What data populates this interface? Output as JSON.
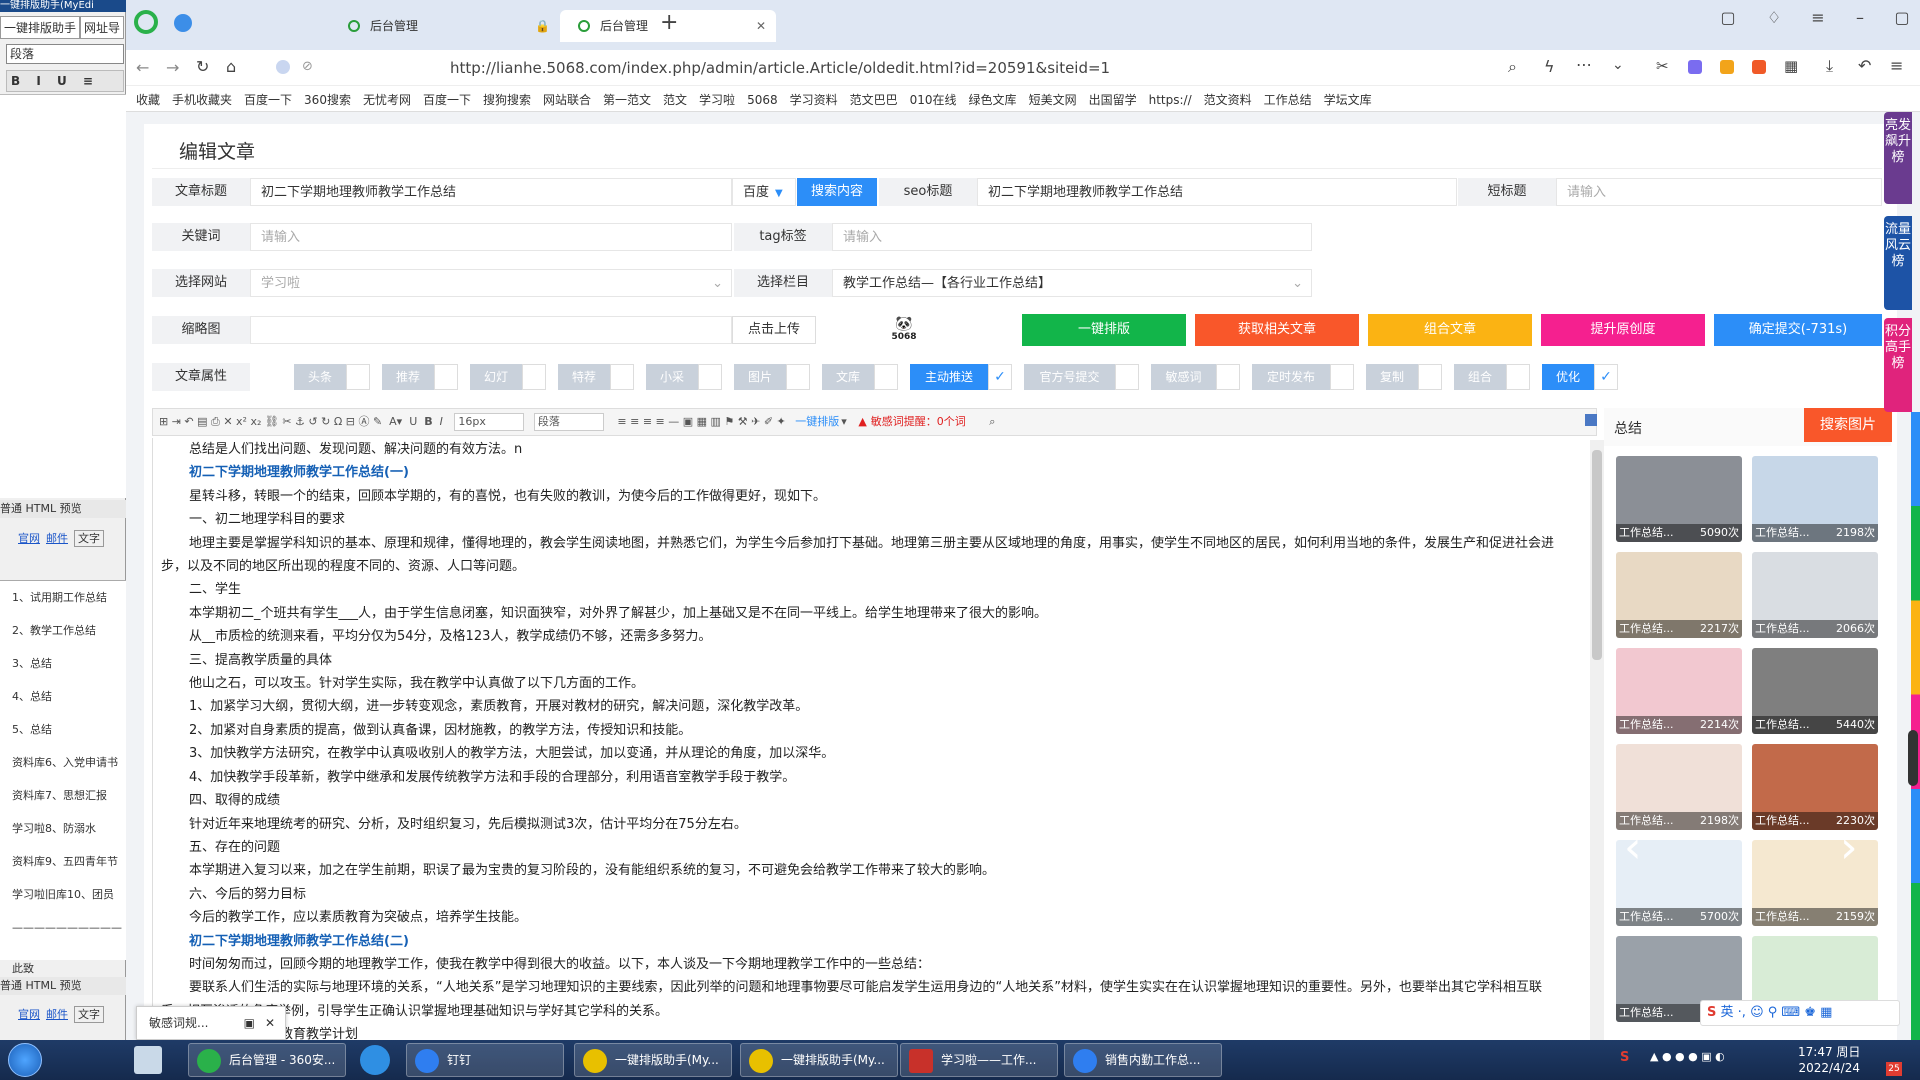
{
  "left_app": {
    "title": "一键排版助手(MyEdi",
    "tabs": [
      "一键排版助手",
      "网址导"
    ],
    "style_select": "段落",
    "format_buttons": "B I U ≡ ≡",
    "mode_tabs": "普通 HTML 预览",
    "links": [
      "官网",
      "邮件",
      "文字"
    ],
    "items": [
      "1、试用期工作总结",
      "2、教学工作总结",
      "3、总结",
      "4、总结",
      "5、总结",
      "资料库6、入党申请书",
      "资料库7、思想汇报",
      "学习啦8、防溺水",
      "资料库9、五四青年节",
      "学习啦旧库10、团员",
      "——————————",
      "此致"
    ],
    "mode_tabs2": "普通 HTML 预览",
    "links2": [
      "官网",
      "邮件",
      "文字"
    ]
  },
  "browser": {
    "tab1_label": "后台管理",
    "tab2_label": "后台管理",
    "url": "http://lianhe.5068.com/index.php/admin/article.Article/oldedit.html?id=20591&siteid=1",
    "bookmarks": [
      "收藏",
      "手机收藏夹",
      "百度一下",
      "360搜索",
      "无忧考网",
      "百度一下",
      "搜狗搜索",
      "网站联合",
      "第一范文",
      "范文",
      "学习啦",
      "5068",
      "学习资料",
      "范文巴巴",
      "010在线",
      "绿色文库",
      "短美文网",
      "出国留学",
      "https://",
      "范文资料",
      "工作总结",
      "学坛文库"
    ]
  },
  "page": {
    "title": "编辑文章",
    "labels": {
      "article_title": "文章标题",
      "seo_title": "seo标题",
      "short_title": "短标题",
      "keywords": "关键词",
      "tag": "tag标签",
      "site": "选择网站",
      "column": "选择栏目",
      "thumbnail": "缩略图",
      "attributes": "文章属性"
    },
    "article_title_value": "初二下学期地理教师教学工作总结",
    "engine": "百度",
    "search_btn": "搜索内容",
    "seo_title_value": "初二下学期地理教师教学工作总结",
    "placeholder": "请输入",
    "site_value": "学习啦",
    "column_value": "教学工作总结—【各行业工作总结】",
    "upload_btn": "点击上传",
    "logo_text": "5068",
    "action_buttons": [
      "一键排版",
      "获取相关文章",
      "组合文章",
      "提升原创度",
      "确定提交(-731s)"
    ],
    "action_colors": [
      "#12b54a",
      "#f9572a",
      "#fbb313",
      "#f5208f",
      "#2c8ef8"
    ],
    "attributes": [
      "头条",
      "推荐",
      "幻灯",
      "特荐",
      "小采",
      "图片",
      "文库",
      "主动推送",
      "官方号提交",
      "敏感词",
      "定时发布",
      "复制",
      "组合",
      "优化"
    ],
    "attributes_on": [
      false,
      false,
      false,
      false,
      false,
      false,
      false,
      true,
      false,
      false,
      false,
      false,
      false,
      true
    ]
  },
  "editor": {
    "font_size": "16px",
    "paragraph": "段落",
    "one_click": "一键排版",
    "sensitive": "敏感词提醒：0个词",
    "lines": [
      {
        "t": "总结是人们找出问题、发现问题、解决问题的有效方法。n",
        "c": ""
      },
      {
        "t": "初二下学期地理教师教学工作总结(一)",
        "c": "h"
      },
      {
        "t": "星转斗移，转眼一个的结束，回顾本学期的，有的喜悦，也有失败的教训，为使今后的工作做得更好，现如下。",
        "c": ""
      },
      {
        "t": "一、初二地理学科目的要求",
        "c": ""
      },
      {
        "t": "地理主要是掌握学科知识的基本、原理和规律，懂得地理的，教会学生阅读地图，并熟悉它们，为学生今后参加打下基础。地理第三册主要从区域地理的角度，用事实，使学生不同地区的居民，如何利用当地的条件，发展生产和促进社会进步，以及不同的地区所出现的程度不同的、资源、人口等问题。",
        "c": "wrap"
      },
      {
        "t": "二、学生",
        "c": ""
      },
      {
        "t": "本学期初二_个班共有学生___人，由于学生信息闭塞，知识面狭窄，对外界了解甚少，加上基础又是不在同一平线上。给学生地理带来了很大的影响。",
        "c": ""
      },
      {
        "t": "从__市质检的统测来看，平均分仅为54分，及格123人，教学成绩仍不够，还需多多努力。",
        "c": ""
      },
      {
        "t": "三、提高教学质量的具体",
        "c": ""
      },
      {
        "t": "他山之石，可以攻玉。针对学生实际，我在教学中认真做了以下几方面的工作。",
        "c": ""
      },
      {
        "t": "1、加紧学习大纲，贯彻大纲，进一步转变观念，素质教育，开展对教材的研究，解决问题，深化教学改革。",
        "c": ""
      },
      {
        "t": "2、加紧对自身素质的提高，做到认真备课，因材施教，的教学方法，传授知识和技能。",
        "c": ""
      },
      {
        "t": "3、加快教学方法研究，在教学中认真吸收别人的教学方法，大胆尝试，加以变通，并从理论的角度，加以深华。",
        "c": ""
      },
      {
        "t": "4、加快教学手段革新，教学中继承和发展传统教学方法和手段的合理部分，利用语音室教学手段于教学。",
        "c": ""
      },
      {
        "t": "四、取得的成绩",
        "c": ""
      },
      {
        "t": "针对近年来地理统考的研究、分析，及时组织复习，先后模拟测试3次，估计平均分在75分左右。",
        "c": ""
      },
      {
        "t": "五、存在的问题",
        "c": ""
      },
      {
        "t": "本学期进入复习以来，加之在学生前期，职误了最为宝贵的复习阶段的，没有能组织系统的复习，不可避免会给教学工作带来了较大的影响。",
        "c": ""
      },
      {
        "t": "六、今后的努力目标",
        "c": ""
      },
      {
        "t": "今后的教学工作，应以素质教育为突破点，培养学生技能。",
        "c": ""
      },
      {
        "t": "初二下学期地理教师教学工作总结(二)",
        "c": "h"
      },
      {
        "t": "时间匆匆而过，回顾今期的地理教学工作，使我在教学中得到很大的收益。以下，本人谈及一下今期地理教学工作中的一些总结：",
        "c": ""
      },
      {
        "t": "要联系人们生活的实际与地理环境的关系，“人地关系”是学习地理知识的主要线索，因此列举的问题和地理事物要尽可能启发学生运用身边的“人地关系”材料，使学生实实在在认识掌握地理知识的重要性。另外，也要举出其它学科相互联系，相互渗透的角度举例，引导学生正确认识掌握地理基础知识与学好其它学科的关系。",
        "c": "wrap"
      },
      {
        "t": "制定合理的学期教育教学计划",
        "c": ""
      }
    ]
  },
  "right_panel": {
    "keyword": "总结",
    "search_btn": "搜索图片",
    "thumbs": [
      {
        "cap": "工作总结...",
        "n": "5090次"
      },
      {
        "cap": "工作总结...",
        "n": "2198次"
      },
      {
        "cap": "工作总结...",
        "n": "2217次"
      },
      {
        "cap": "工作总结...",
        "n": "2066次"
      },
      {
        "cap": "工作总结...",
        "n": "2214次"
      },
      {
        "cap": "工作总结...",
        "n": "5440次"
      },
      {
        "cap": "工作总结...",
        "n": "2198次"
      },
      {
        "cap": "工作总结...",
        "n": "2230次"
      },
      {
        "cap": "工作总结...",
        "n": "5700次"
      },
      {
        "cap": "工作总结...",
        "n": "2159次"
      },
      {
        "cap": "工作总结...",
        "n": ""
      },
      {
        "cap": "",
        "n": ""
      }
    ],
    "thumb_colors": [
      "#8b8f96",
      "#c7d7e8",
      "#e8d9c4",
      "#d9dde2",
      "#f2c8d0",
      "#7f7f7f",
      "#f0e0d8",
      "#c26a4a",
      "#e6eef6",
      "#f5e8d0",
      "#9aa1a9",
      "#d8ecd6"
    ]
  },
  "ribbons": {
    "r1": "亮发飙升榜",
    "r2": "流量风云榜",
    "r3": "积分高手榜"
  },
  "popup": {
    "text": "敏感词规..."
  },
  "taskbar": {
    "items": [
      "后台管理 - 360安...",
      "钉钉",
      "一键排版助手(My...",
      "一键排版助手(My...",
      "学习啦——工作...",
      "销售内勤工作总..."
    ],
    "time": "17:47 周日",
    "date": "2022/4/24",
    "ime": "英"
  }
}
